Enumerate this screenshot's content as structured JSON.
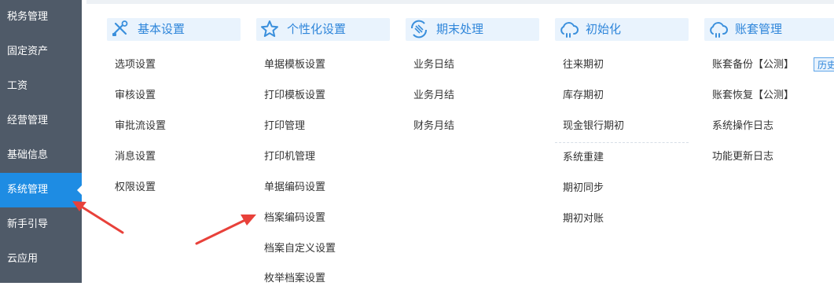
{
  "sidebar": {
    "items": [
      {
        "label": "税务管理"
      },
      {
        "label": "固定资产"
      },
      {
        "label": "工资"
      },
      {
        "label": "经营管理"
      },
      {
        "label": "基础信息"
      },
      {
        "label": "系统管理"
      },
      {
        "label": "新手引导"
      },
      {
        "label": "云应用"
      }
    ],
    "active_item": "系统管理"
  },
  "columns": [
    {
      "title": "基本设置",
      "icon": "tools-icon",
      "items": [
        "选项设置",
        "审核设置",
        "审批流设置",
        "消息设置",
        "权限设置"
      ]
    },
    {
      "title": "个性化设置",
      "icon": "star-icon",
      "items": [
        "单据模板设置",
        "打印模板设置",
        "打印管理",
        "打印机管理",
        "单据编码设置",
        "档案编码设置",
        "档案自定义设置",
        "枚举档案设置"
      ]
    },
    {
      "title": "期末处理",
      "icon": "period-end-icon",
      "items": [
        "业务日结",
        "业务月结",
        "财务月结"
      ]
    },
    {
      "title": "初始化",
      "icon": "cloud-icon",
      "items": [
        "往来期初",
        "库存期初",
        "现金银行期初",
        "系统重建",
        "期初同步",
        "期初对账"
      ]
    },
    {
      "title": "账套管理",
      "icon": "cloud-icon",
      "items": [
        "账套备份【公测】",
        "账套恢复【公测】",
        "系统操作日志",
        "功能更新日志"
      ]
    }
  ],
  "history_button": {
    "label": "历史"
  },
  "colors": {
    "sidebar_bg": "#4f5a68",
    "sidebar_active": "#1e8ce3",
    "header_bg": "#e9f3fd",
    "header_text": "#2f86da",
    "annotation_arrow": "#e8413a"
  }
}
